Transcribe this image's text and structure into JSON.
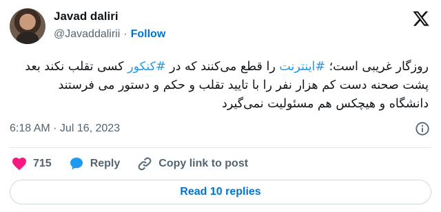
{
  "author": {
    "name": "Javad daliri",
    "handle": "@Javaddalirii",
    "separator": "·",
    "follow_label": "Follow"
  },
  "tweet": {
    "segments": [
      {
        "text": "روزگار غریبی است؛ ",
        "type": "text"
      },
      {
        "text": "#اینترنت",
        "type": "hashtag"
      },
      {
        "text": " را قطع می‌کنند که در ",
        "type": "text"
      },
      {
        "text": "#کنکور",
        "type": "hashtag"
      },
      {
        "text": " کسی تقلب نکند بعد پشت صحنه دست کم هزار نفر را با تایید تقلب و حکم و دستور می فرستند دانشگاه و  هیچکس هم مسئولیت نمی‌گیرد",
        "type": "text"
      }
    ],
    "timestamp": "6:18 AM · Jul 16, 2023"
  },
  "actions": {
    "like_count": "715",
    "reply_label": "Reply",
    "copy_link_label": "Copy link to post"
  },
  "footer": {
    "read_replies_label": "Read 10 replies"
  },
  "colors": {
    "accent": "#1d9bf0",
    "link": "#0074d4",
    "like": "#f91880",
    "muted": "#536471"
  },
  "icons": {
    "logo": "x-logo-icon",
    "info": "info-icon",
    "like": "heart-icon",
    "reply": "reply-bubble-icon",
    "copy": "link-icon"
  }
}
